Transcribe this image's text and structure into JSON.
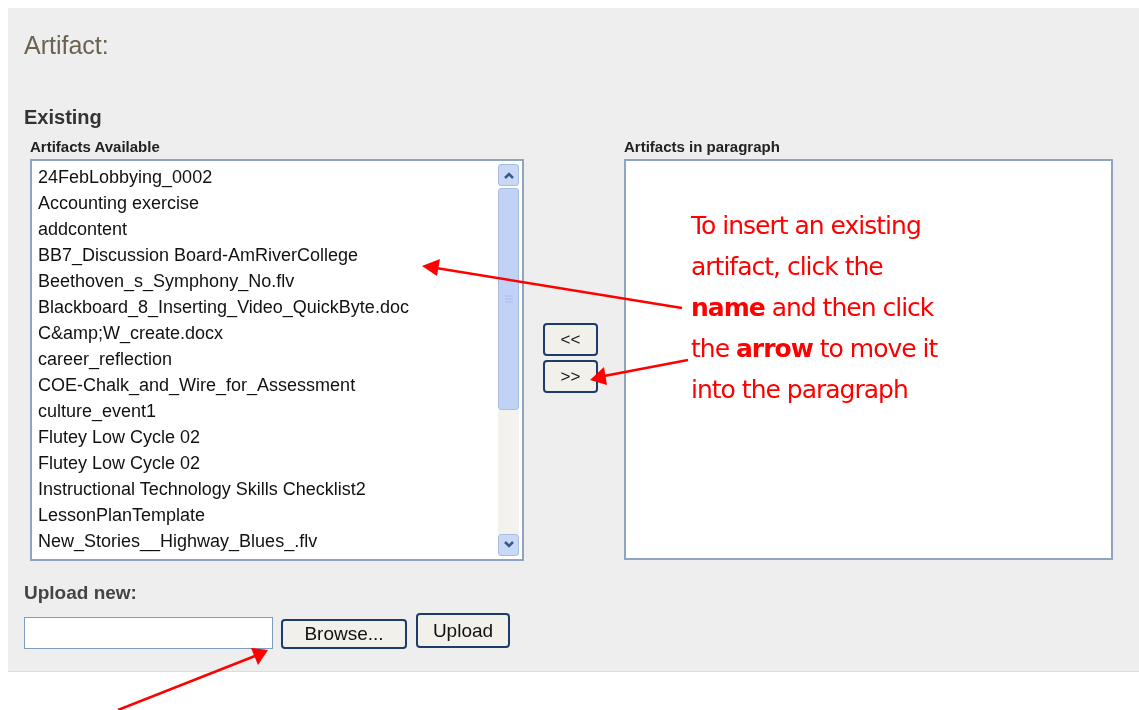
{
  "title": "Artifact:",
  "existing": {
    "heading": "Existing",
    "available": {
      "label": "Artifacts Available",
      "items": [
        {
          "text": "24FebLobbying_0002",
          "selected": false
        },
        {
          "text": "Accounting exercise",
          "selected": false
        },
        {
          "text": "addcontent",
          "selected": false
        },
        {
          "text": "BB7_Discussion Board-AmRiverCollege",
          "selected": false
        },
        {
          "text": "Beethoven_s_Symphony_No.flv",
          "selected": false
        },
        {
          "text": "Blackboard_8_Inserting_Video_QuickByte.doc",
          "selected": false
        },
        {
          "text": "C&amp;W_create.docx",
          "selected": false
        },
        {
          "text": "career_reflection",
          "selected": false
        },
        {
          "text": "COE-Chalk_and_Wire_for_Assessment",
          "selected": false
        },
        {
          "text": "culture_event1",
          "selected": false
        },
        {
          "text": "Flutey Low Cycle 02",
          "selected": false
        },
        {
          "text": "Flutey Low Cycle 02",
          "selected": false
        },
        {
          "text": "Instructional Technology Skills Checklist2",
          "selected": false
        },
        {
          "text": "LessonPlanTemplate",
          "selected": false
        },
        {
          "text": "New_Stories__Highway_Blues_.flv",
          "selected": false
        }
      ]
    },
    "move_buttons": [
      "<<",
      ">>"
    ],
    "in_paragraph": {
      "label": "Artifacts in paragraph"
    }
  },
  "annotation": {
    "lines": [
      "To insert an existing",
      "artifact, click the",
      "**name** and then click",
      "the **arrow** to move it",
      "into the paragraph"
    ]
  },
  "upload": {
    "label": "Upload new:",
    "browse_button": "Browse...",
    "upload_button": "Upload"
  }
}
